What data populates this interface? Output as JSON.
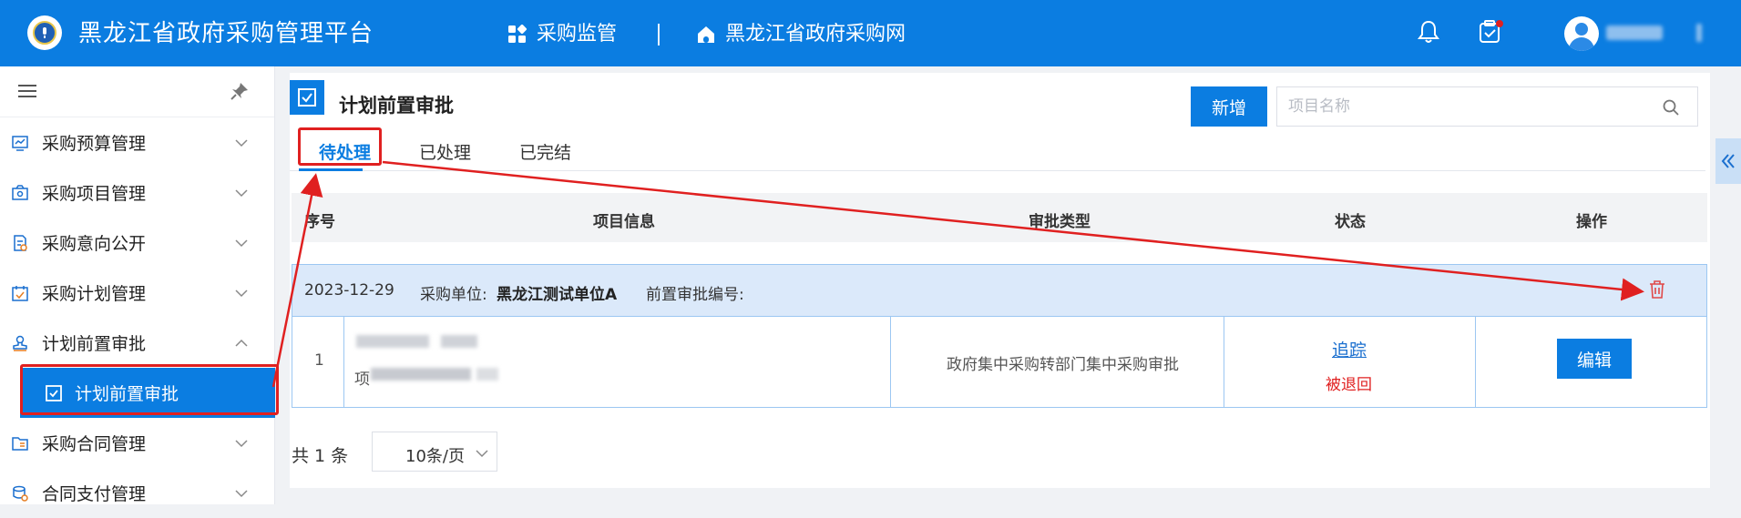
{
  "header": {
    "app_title": "黑龙江省政府采购管理平台",
    "nav": [
      {
        "label": "采购监管",
        "icon": "grid-icon"
      },
      {
        "label": "黑龙江省政府采购网",
        "icon": "home-icon"
      }
    ],
    "icons": [
      "bell-icon",
      "task-check-icon",
      "user-avatar-icon"
    ],
    "badge_color": "#e02020"
  },
  "sidebar": {
    "items": [
      {
        "label": "采购预算管理",
        "icon": "chart-board-icon",
        "expanded": false
      },
      {
        "label": "采购项目管理",
        "icon": "project-icon",
        "expanded": false
      },
      {
        "label": "采购意向公开",
        "icon": "document-icon",
        "expanded": false
      },
      {
        "label": "采购计划管理",
        "icon": "calendar-check-icon",
        "expanded": false
      },
      {
        "label": "计划前置审批",
        "icon": "stamp-icon",
        "expanded": true
      },
      {
        "label": "采购合同管理",
        "icon": "folder-list-icon",
        "expanded": false
      },
      {
        "label": "合同支付管理",
        "icon": "coins-icon",
        "expanded": false
      }
    ],
    "active_sub": {
      "label": "计划前置审批",
      "icon": "check-square-icon"
    }
  },
  "page": {
    "title": "计划前置审批",
    "new_button": "新增",
    "search_placeholder": "项目名称",
    "tabs": [
      {
        "label": "待处理",
        "active": true
      },
      {
        "label": "已处理",
        "active": false
      },
      {
        "label": "已完结",
        "active": false
      }
    ]
  },
  "table": {
    "headers": [
      "序号",
      "项目信息",
      "审批类型",
      "状态",
      "操作"
    ],
    "group": {
      "date": "2023-12-29",
      "unit_label": "采购单位:",
      "unit_value": "黑龙江测试单位A",
      "code_label": "前置审批编号:"
    },
    "rows": [
      {
        "index": "1",
        "project_prefix": "项",
        "approval_type": "政府集中采购转部门集中采购审批",
        "track_link": "追踪",
        "status": "被退回",
        "action": "编辑"
      }
    ]
  },
  "pagination": {
    "total": "共 1 条",
    "page_size": "10条/页"
  },
  "colors": {
    "primary": "#0b7de1",
    "highlight_row": "#dbe9fa",
    "annotation_red": "#e02020"
  }
}
